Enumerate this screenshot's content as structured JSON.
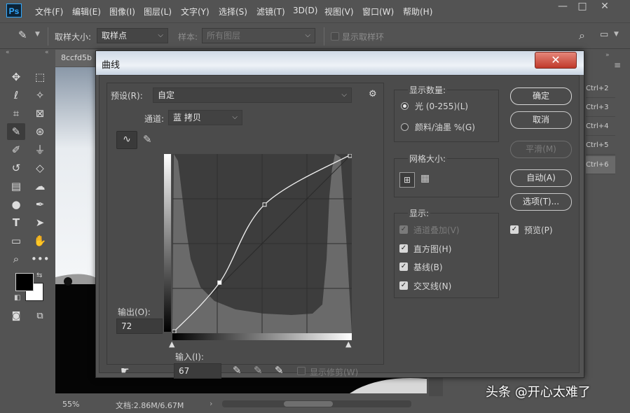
{
  "app": {
    "logo": "Ps"
  },
  "menu": [
    "文件(F)",
    "编辑(E)",
    "图像(I)",
    "图层(L)",
    "文字(Y)",
    "选择(S)",
    "滤镜(T)",
    "3D(D)",
    "视图(V)",
    "窗口(W)",
    "帮助(H)"
  ],
  "window_controls": {
    "minimize": "—",
    "maximize": "□",
    "close": "✕"
  },
  "options_bar": {
    "sample_size_label": "取样大小:",
    "sample_size_value": "取样点",
    "sample_label": "样本:",
    "sample_value": "所有图层",
    "show_ring_label": "显示取样环"
  },
  "document": {
    "tab_label": "8ccfd5b",
    "zoom": "55%",
    "doc_info": "文档:2.86M/6.67M"
  },
  "shortcuts": [
    "Ctrl+2",
    "Ctrl+3",
    "Ctrl+4",
    "Ctrl+5",
    "Ctrl+6"
  ],
  "dialog": {
    "title": "曲线",
    "close_label": "✕",
    "preset_label": "预设(R):",
    "preset_value": "自定",
    "channel_label": "通道:",
    "channel_value": "蓝 拷贝",
    "output_label": "输出(O):",
    "output_value": "72",
    "input_label": "输入(I):",
    "input_value": "67",
    "show_clipping_label": "显示修剪(W)",
    "display_amount": {
      "title": "显示数量:",
      "options": [
        {
          "label": "光 (0-255)(L)",
          "selected": true
        },
        {
          "label": "颜料/油墨 %(G)",
          "selected": false
        }
      ]
    },
    "grid_size": {
      "title": "网格大小:"
    },
    "show": {
      "title": "显示:",
      "options": [
        {
          "label": "通道叠加(V)",
          "checked": true,
          "enabled": false
        },
        {
          "label": "直方图(H)",
          "checked": true,
          "enabled": true
        },
        {
          "label": "基线(B)",
          "checked": true,
          "enabled": true
        },
        {
          "label": "交叉线(N)",
          "checked": true,
          "enabled": true
        }
      ]
    },
    "buttons": {
      "ok": "确定",
      "cancel": "取消",
      "smooth": "平滑(M)",
      "auto": "自动(A)",
      "options": "选项(T)..."
    },
    "preview_label": "预览(P)",
    "curve_points": [
      {
        "input": 0,
        "output": 0
      },
      {
        "input": 67,
        "output": 72
      },
      {
        "input": 131,
        "output": 183
      },
      {
        "input": 255,
        "output": 255
      }
    ]
  },
  "watermark": "头条 @开心太难了"
}
